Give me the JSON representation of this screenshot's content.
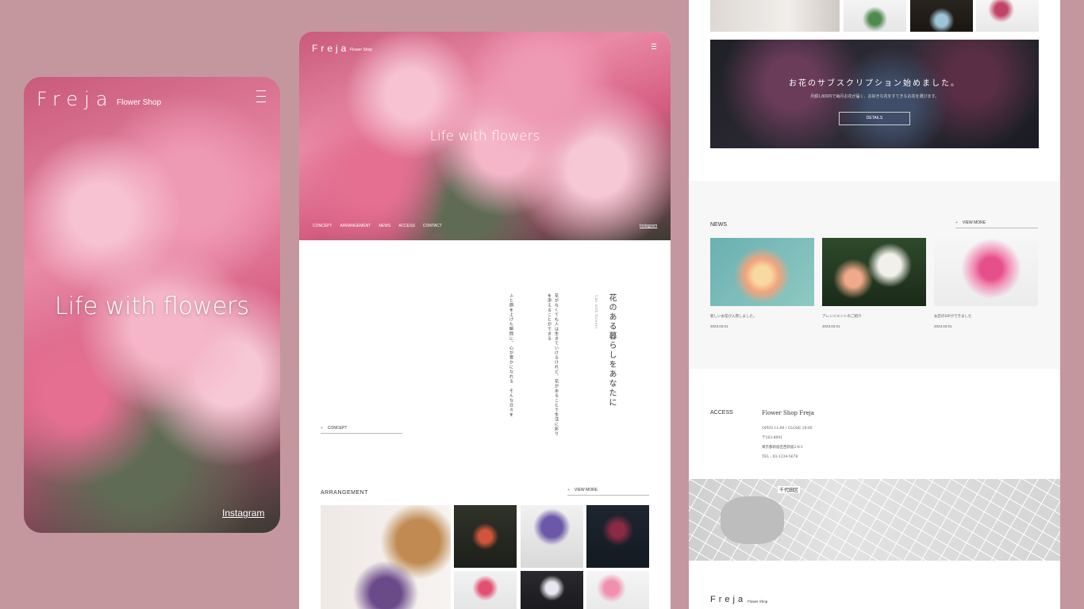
{
  "phone": {
    "logo": "Freja",
    "logo_sub": "Flower Shop",
    "hero_text": "Life with flowers",
    "instagram": "Instagram"
  },
  "desktop": {
    "logo": "Freja",
    "logo_sub": "Flower Shop",
    "hero_text": "Life with flowers",
    "nav": [
      "CONCEPT",
      "ARRANGEMENT",
      "NEWS",
      "ACCESS",
      "CONTACT"
    ],
    "instagram": "Instagram",
    "concept": {
      "title": "花のある暮らしをあなたに",
      "subtitle": "Life with flowers",
      "body_1": "花がなくても人は生きていけるけれど、花があることで生活に彩りを添えることができる",
      "body_2": "ふと顔を上げた瞬間に、心が豊かになれる　そんな日々を",
      "link": "CONCEPT"
    },
    "arrangement": {
      "title": "ARRANGEMENT",
      "more": "VIEW MORE"
    }
  },
  "right": {
    "subscription": {
      "title": "お花のサブスクリプション始めました。",
      "text": "月額1,800円で毎月お花が届く、お好きな花をすてきなお花を選びます。",
      "button": "DETAILS"
    },
    "news": {
      "title": "NEWS",
      "more": "VIEW MORE",
      "items": [
        {
          "title": "新しいお花が入荷しました。",
          "date": "2023.03.01"
        },
        {
          "title": "アレンジメントのご紹介",
          "date": "2023.03.01"
        },
        {
          "title": "お店のHPができました",
          "date": "2023.03.01"
        }
      ]
    },
    "access": {
      "title": "ACCESS",
      "name": "Flower Shop  Freja",
      "lines": [
        "OPEN 11:00 / CLOSE 19:00",
        "〒163-8001",
        "東京都新宿区西新宿2-8-1",
        "TEL : 03-1234-5678"
      ]
    },
    "map_label": "千代田区",
    "footer": {
      "logo": "Freja",
      "sub": "Flower Shop"
    }
  },
  "colors": {
    "background": "#c4979e",
    "accent": "#e98aa7"
  }
}
